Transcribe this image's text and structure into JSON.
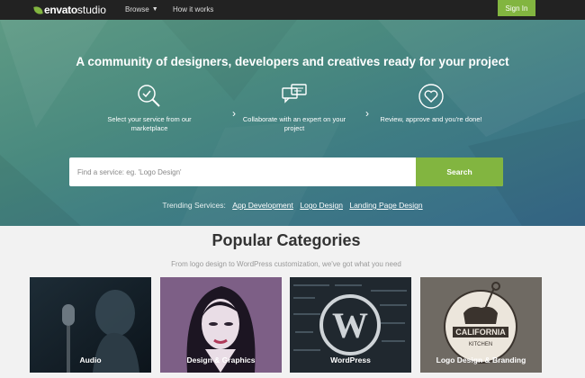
{
  "header": {
    "logo_brand": "envato",
    "logo_sub": "studio",
    "nav": [
      {
        "label": "Browse"
      },
      {
        "label": "How it works"
      }
    ],
    "signin_label": "Sign In"
  },
  "hero": {
    "title": "A community of designers, developers and creatives ready for your project",
    "steps": [
      {
        "icon": "magnifier-check-icon",
        "text": "Select your service from our marketplace"
      },
      {
        "icon": "chat-bubbles-icon",
        "text": "Collaborate with an expert on your project"
      },
      {
        "icon": "heart-badge-icon",
        "text": "Review, approve and you're done!"
      }
    ],
    "search": {
      "placeholder": "Find a service: eg. 'Logo Design'",
      "button_label": "Search"
    },
    "trending": {
      "label": "Trending Services:",
      "links": [
        "App Development",
        "Logo Design",
        "Landing Page Design"
      ]
    }
  },
  "popular": {
    "title": "Popular Categories",
    "subtitle": "From logo design to WordPress customization, we've got what you need",
    "categories": [
      {
        "label": "Audio"
      },
      {
        "label": "Design & Graphics"
      },
      {
        "label": "WordPress"
      },
      {
        "label": "Logo Design & Branding",
        "logo_text": "CALIFORNIA",
        "logo_sub": "KITCHEN"
      }
    ]
  },
  "colors": {
    "accent_green": "#82b540",
    "topbar": "#222222",
    "hero_start": "#5e9a84",
    "hero_end": "#36698a"
  }
}
